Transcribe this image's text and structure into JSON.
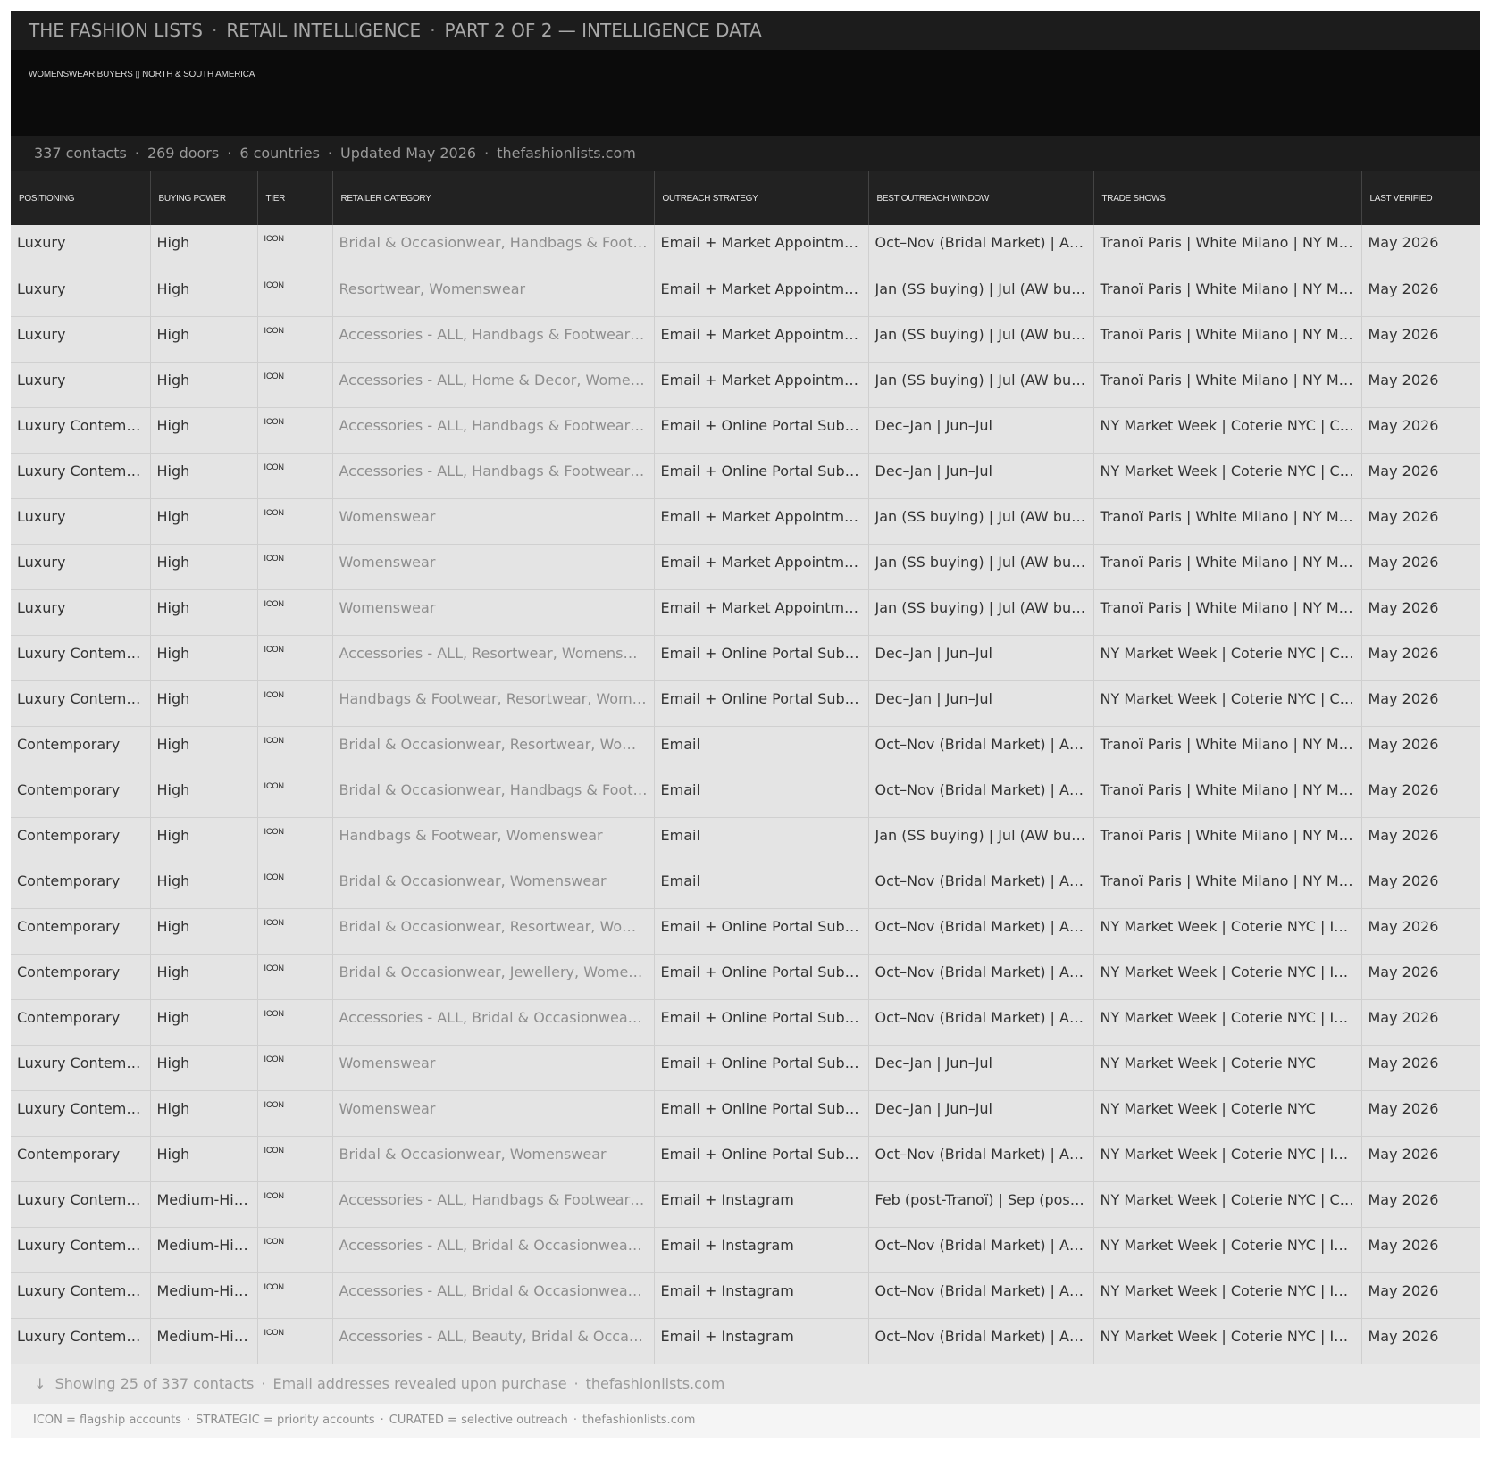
{
  "header": {
    "parts": [
      "THE FASHION LISTS",
      "RETAIL INTELLIGENCE",
      "PART 2 OF 2 — INTELLIGENCE DATA"
    ],
    "subtitle": "WOMENSWEAR BUYERS ▯ NORTH & SOUTH AMERICA"
  },
  "stats": [
    "337 contacts",
    "269 doors",
    "6 countries",
    "Updated May 2026",
    "thefashionlists.com"
  ],
  "columns": [
    "POSITIONING",
    "BUYING POWER",
    "TIER",
    "RETAILER CATEGORY",
    "OUTREACH STRATEGY",
    "BEST OUTREACH WINDOW",
    "TRADE SHOWS",
    "LAST VERIFIED"
  ],
  "rows": [
    [
      "Luxury",
      "High",
      "ICON",
      "Bridal & Occasionwear, Handbags & Foot…",
      "Email + Market Appointm…",
      "Oct–Nov (Bridal Market) | A…",
      "Tranoï Paris | White Milano | NY M…",
      "May 2026"
    ],
    [
      "Luxury",
      "High",
      "ICON",
      "Resortwear, Womenswear",
      "Email + Market Appointm…",
      "Jan (SS buying) | Jul (AW bu…",
      "Tranoï Paris | White Milano | NY M…",
      "May 2026"
    ],
    [
      "Luxury",
      "High",
      "ICON",
      "Accessories - ALL, Handbags & Footwear…",
      "Email + Market Appointm…",
      "Jan (SS buying) | Jul (AW bu…",
      "Tranoï Paris | White Milano | NY M…",
      "May 2026"
    ],
    [
      "Luxury",
      "High",
      "ICON",
      "Accessories - ALL, Home & Decor, Wome…",
      "Email + Market Appointm…",
      "Jan (SS buying) | Jul (AW bu…",
      "Tranoï Paris | White Milano | NY M…",
      "May 2026"
    ],
    [
      "Luxury Contem…",
      "High",
      "ICON",
      "Accessories - ALL, Handbags & Footwear…",
      "Email + Online Portal Sub…",
      "Dec–Jan | Jun–Jul",
      "NY Market Week | Coterie NYC | C…",
      "May 2026"
    ],
    [
      "Luxury Contem…",
      "High",
      "ICON",
      "Accessories - ALL, Handbags & Footwear…",
      "Email + Online Portal Sub…",
      "Dec–Jan | Jun–Jul",
      "NY Market Week | Coterie NYC | C…",
      "May 2026"
    ],
    [
      "Luxury",
      "High",
      "ICON",
      "Womenswear",
      "Email + Market Appointm…",
      "Jan (SS buying) | Jul (AW bu…",
      "Tranoï Paris | White Milano | NY M…",
      "May 2026"
    ],
    [
      "Luxury",
      "High",
      "ICON",
      "Womenswear",
      "Email + Market Appointm…",
      "Jan (SS buying) | Jul (AW bu…",
      "Tranoï Paris | White Milano | NY M…",
      "May 2026"
    ],
    [
      "Luxury",
      "High",
      "ICON",
      "Womenswear",
      "Email + Market Appointm…",
      "Jan (SS buying) | Jul (AW bu…",
      "Tranoï Paris | White Milano | NY M…",
      "May 2026"
    ],
    [
      "Luxury Contem…",
      "High",
      "ICON",
      "Accessories - ALL, Resortwear, Womens…",
      "Email + Online Portal Sub…",
      "Dec–Jan | Jun–Jul",
      "NY Market Week | Coterie NYC | C…",
      "May 2026"
    ],
    [
      "Luxury Contem…",
      "High",
      "ICON",
      "Handbags & Footwear, Resortwear, Wom…",
      "Email + Online Portal Sub…",
      "Dec–Jan | Jun–Jul",
      "NY Market Week | Coterie NYC | C…",
      "May 2026"
    ],
    [
      "Contemporary",
      "High",
      "ICON",
      "Bridal & Occasionwear, Resortwear, Wo…",
      "Email",
      "Oct–Nov (Bridal Market) | A…",
      "Tranoï Paris | White Milano | NY M…",
      "May 2026"
    ],
    [
      "Contemporary",
      "High",
      "ICON",
      "Bridal & Occasionwear, Handbags & Foot…",
      "Email",
      "Oct–Nov (Bridal Market) | A…",
      "Tranoï Paris | White Milano | NY M…",
      "May 2026"
    ],
    [
      "Contemporary",
      "High",
      "ICON",
      "Handbags & Footwear, Womenswear",
      "Email",
      "Jan (SS buying) | Jul (AW bu…",
      "Tranoï Paris | White Milano | NY M…",
      "May 2026"
    ],
    [
      "Contemporary",
      "High",
      "ICON",
      "Bridal & Occasionwear, Womenswear",
      "Email",
      "Oct–Nov (Bridal Market) | A…",
      "Tranoï Paris | White Milano | NY M…",
      "May 2026"
    ],
    [
      "Contemporary",
      "High",
      "ICON",
      "Bridal & Occasionwear, Resortwear, Wo…",
      "Email + Online Portal Sub…",
      "Oct–Nov (Bridal Market) | A…",
      "NY Market Week | Coterie NYC | I…",
      "May 2026"
    ],
    [
      "Contemporary",
      "High",
      "ICON",
      "Bridal & Occasionwear, Jewellery, Wome…",
      "Email + Online Portal Sub…",
      "Oct–Nov (Bridal Market) | A…",
      "NY Market Week | Coterie NYC | I…",
      "May 2026"
    ],
    [
      "Contemporary",
      "High",
      "ICON",
      "Accessories - ALL, Bridal & Occasionwear…",
      "Email + Online Portal Sub…",
      "Oct–Nov (Bridal Market) | A…",
      "NY Market Week | Coterie NYC | I…",
      "May 2026"
    ],
    [
      "Luxury Contem…",
      "High",
      "ICON",
      "Womenswear",
      "Email + Online Portal Sub…",
      "Dec–Jan | Jun–Jul",
      "NY Market Week | Coterie NYC",
      "May 2026"
    ],
    [
      "Luxury Contem…",
      "High",
      "ICON",
      "Womenswear",
      "Email + Online Portal Sub…",
      "Dec–Jan | Jun–Jul",
      "NY Market Week | Coterie NYC",
      "May 2026"
    ],
    [
      "Contemporary",
      "High",
      "ICON",
      "Bridal & Occasionwear, Womenswear",
      "Email + Online Portal Sub…",
      "Oct–Nov (Bridal Market) | A…",
      "NY Market Week | Coterie NYC | I…",
      "May 2026"
    ],
    [
      "Luxury Contem…",
      "Medium-Hi…",
      "ICON",
      "Accessories - ALL, Handbags & Footwear…",
      "Email + Instagram",
      "Feb (post-Tranoï) | Sep (pos…",
      "NY Market Week | Coterie NYC | C…",
      "May 2026"
    ],
    [
      "Luxury Contem…",
      "Medium-Hi…",
      "ICON",
      "Accessories - ALL, Bridal & Occasionwear…",
      "Email + Instagram",
      "Oct–Nov (Bridal Market) | A…",
      "NY Market Week | Coterie NYC | I…",
      "May 2026"
    ],
    [
      "Luxury Contem…",
      "Medium-Hi…",
      "ICON",
      "Accessories - ALL, Bridal & Occasionwear…",
      "Email + Instagram",
      "Oct–Nov (Bridal Market) | A…",
      "NY Market Week | Coterie NYC | I…",
      "May 2026"
    ],
    [
      "Luxury Contem…",
      "Medium-Hi…",
      "ICON",
      "Accessories - ALL, Beauty, Bridal & Occa…",
      "Email + Instagram",
      "Oct–Nov (Bridal Market) | A…",
      "NY Market Week | Coterie NYC | I…",
      "May 2026"
    ]
  ],
  "footer": {
    "arrow": "↓",
    "items": [
      "Showing 25 of 337 contacts",
      "Email addresses revealed upon purchase",
      "thefashionlists.com"
    ],
    "legend": [
      "ICON = flagship accounts",
      "STRATEGIC = priority accounts",
      "CURATED = selective outreach",
      "thefashionlists.com"
    ]
  }
}
